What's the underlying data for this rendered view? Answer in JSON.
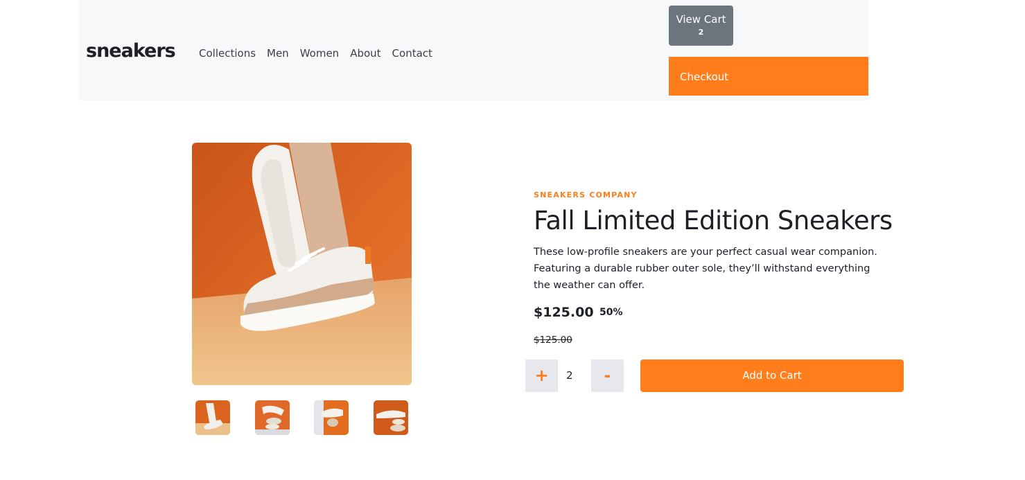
{
  "header": {
    "logo": "sneakers",
    "nav": [
      "Collections",
      "Men",
      "Women",
      "About",
      "Contact"
    ],
    "view_cart_label": "View Cart",
    "cart_count": "2",
    "checkout_label": "Checkout"
  },
  "gallery": {
    "hero_image": "sneaker-photo-orange-background",
    "thumbnails": [
      "thumbnail-1",
      "thumbnail-2",
      "thumbnail-3",
      "thumbnail-4"
    ]
  },
  "product": {
    "company": "SNEAKERS COMPANY",
    "title": "Fall Limited Edition Sneakers",
    "description": "These low-profile sneakers are your perfect casual wear companion. Featuring a durable rubber outer sole, they’ll withstand everything the weather can offer.",
    "price": "$125.00",
    "discount": "50%",
    "original_price": "$125.00"
  },
  "quantity": {
    "plus_label": "+",
    "value": "2",
    "minus_label": "-"
  },
  "add_to_cart_label": "Add to Cart",
  "colors": {
    "accent": "#ff7e1b",
    "header_bg": "#f7f8fa",
    "view_cart_bg": "#6c757d",
    "text": "#1d2026"
  }
}
